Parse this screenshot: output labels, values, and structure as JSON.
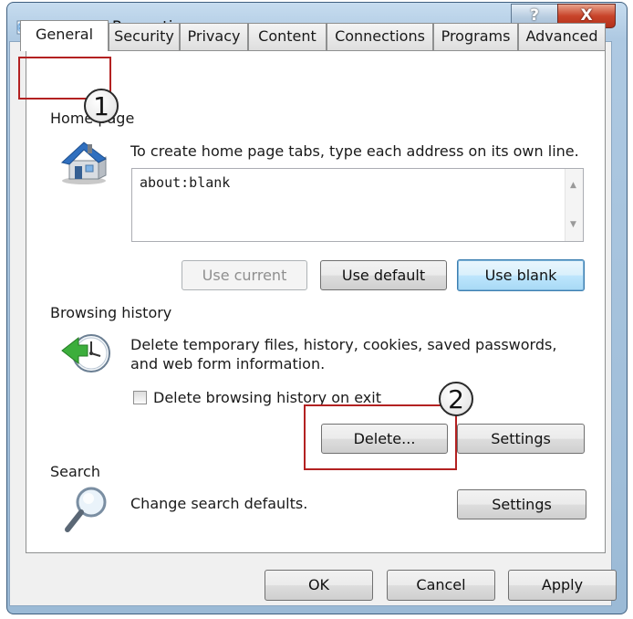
{
  "window": {
    "title": "Internet Properties",
    "help_glyph": "?",
    "close_glyph": "X",
    "icon": "internet-options-icon"
  },
  "tabs": [
    {
      "label": "General",
      "selected": true
    },
    {
      "label": "Security",
      "selected": false
    },
    {
      "label": "Privacy",
      "selected": false
    },
    {
      "label": "Content",
      "selected": false
    },
    {
      "label": "Connections",
      "selected": false
    },
    {
      "label": "Programs",
      "selected": false
    },
    {
      "label": "Advanced",
      "selected": false
    }
  ],
  "home_page": {
    "group_label": "Home page",
    "instruction": "To create home page tabs, type each address on its own line.",
    "value": "about:blank",
    "icon": "house-icon",
    "use_current": "Use current",
    "use_default": "Use default",
    "use_blank": "Use blank"
  },
  "browsing_history": {
    "group_label": "Browsing history",
    "description_line1": "Delete temporary files, history, cookies, saved passwords,",
    "description_line2": "and web form information.",
    "icon": "history-clock-icon",
    "checkbox_label": "Delete browsing history on exit",
    "checkbox_checked": false,
    "delete_button": "Delete...",
    "settings_button": "Settings"
  },
  "search": {
    "group_label": "Search",
    "description": "Change search defaults.",
    "icon": "magnifier-icon",
    "settings_button": "Settings"
  },
  "footer": {
    "ok": "OK",
    "cancel": "Cancel",
    "apply": "Apply"
  },
  "annotations": {
    "step1": "1",
    "step2": "2",
    "highlight_color": "#b32121"
  }
}
